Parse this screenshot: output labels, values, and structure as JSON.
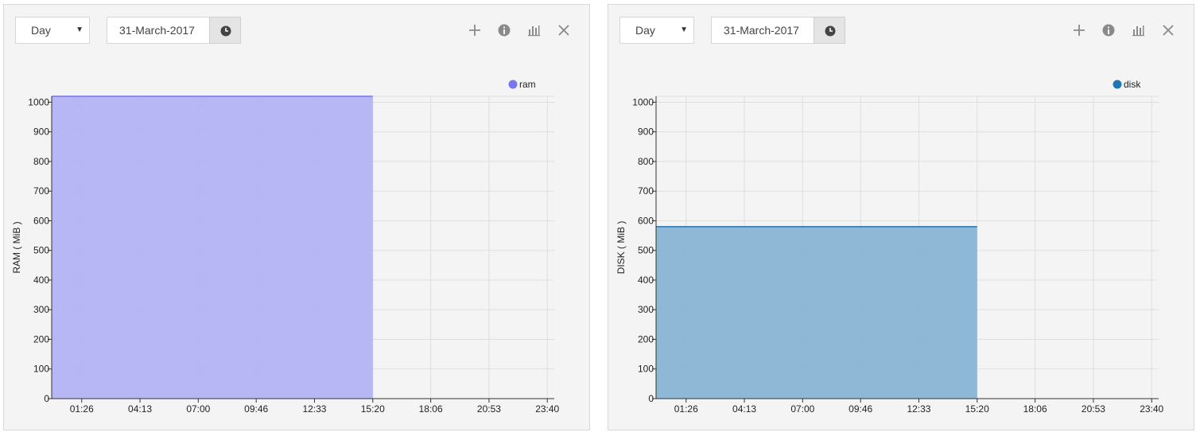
{
  "panels": [
    {
      "period": "Day",
      "date": "31-March-2017",
      "color": "#7777f0",
      "fill_color": "#b3b3f6",
      "chart_data": {
        "type": "area",
        "series": [
          {
            "name": "ram",
            "x": [
              "00:00",
              "15:20"
            ],
            "values": [
              1020,
              1020
            ]
          }
        ],
        "x_ticks": [
          "01:26",
          "04:13",
          "07:00",
          "09:46",
          "12:33",
          "15:20",
          "18:06",
          "20:53",
          "23:40"
        ],
        "ylabel": "RAM ( MiB )",
        "ylim": [
          0,
          1020
        ],
        "y_ticks": [
          0,
          100,
          200,
          300,
          400,
          500,
          600,
          700,
          800,
          900,
          1000
        ],
        "grid": true,
        "legend": "top-right"
      }
    },
    {
      "period": "Day",
      "date": "31-March-2017",
      "color": "#1f77b4",
      "fill_color": "#88b4d4",
      "chart_data": {
        "type": "area",
        "series": [
          {
            "name": "disk",
            "x": [
              "00:00",
              "15:20"
            ],
            "values": [
              580,
              580
            ]
          }
        ],
        "x_ticks": [
          "01:26",
          "04:13",
          "07:00",
          "09:46",
          "12:33",
          "15:20",
          "18:06",
          "20:53",
          "23:40"
        ],
        "ylabel": "DISK ( MiB )",
        "ylim": [
          0,
          1020
        ],
        "y_ticks": [
          0,
          100,
          200,
          300,
          400,
          500,
          600,
          700,
          800,
          900,
          1000
        ],
        "grid": true,
        "legend": "top-right"
      }
    }
  ],
  "icons": {
    "add": "plus-icon",
    "info": "info-icon",
    "chart": "bar-chart-icon",
    "close": "close-icon",
    "clock": "clock-icon",
    "caret": "caret-down-icon"
  }
}
